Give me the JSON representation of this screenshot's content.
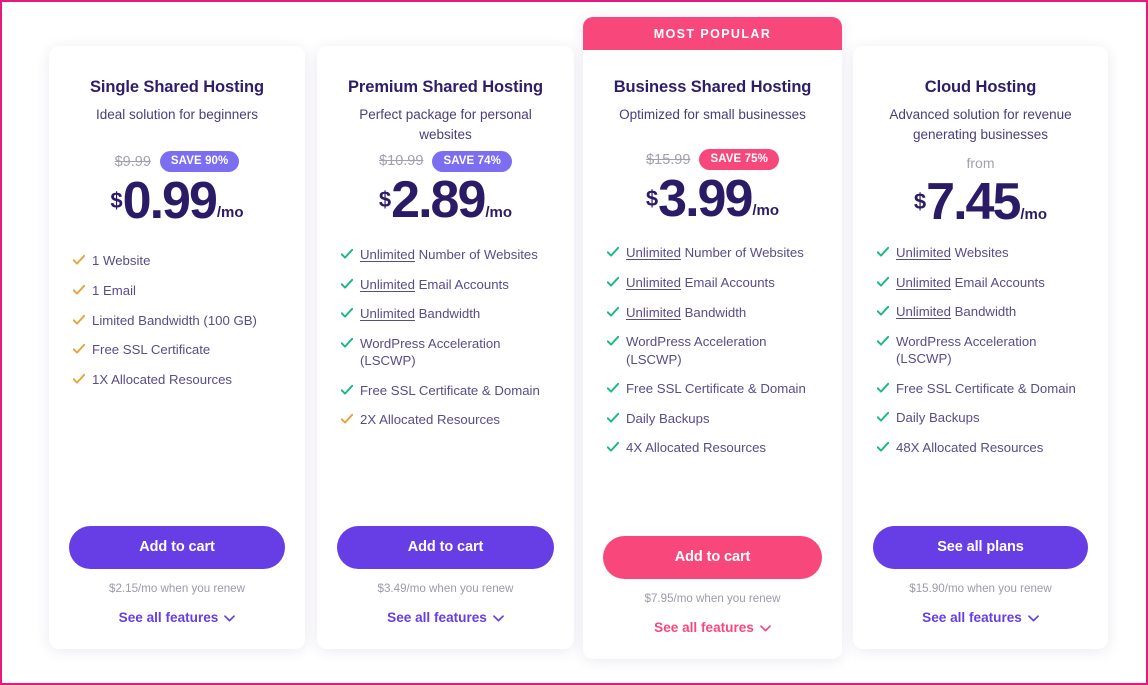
{
  "accent": {
    "purple": "#673de6",
    "badge_purple": "#7c6ef0",
    "pink": "#f8487b",
    "title_navy": "#2f1c6a",
    "check_green": "#19b97d",
    "check_orange": "#e8a33d",
    "page_border": "#e5187f"
  },
  "ribbon": {
    "label": "MOST POPULAR"
  },
  "plans": [
    {
      "id": "single-shared-hosting",
      "title": "Single Shared Hosting",
      "subtitle": "Ideal solution for beginners",
      "old_price": "$9.99",
      "save_badge": "SAVE 90%",
      "from_label": "",
      "currency": "$",
      "price": "0.99",
      "period": "/mo",
      "features": [
        {
          "highlight": "",
          "text": "1 Website",
          "check": "orange"
        },
        {
          "highlight": "",
          "text": "1 Email",
          "check": "orange"
        },
        {
          "highlight": "",
          "text": "Limited Bandwidth (100 GB)",
          "check": "orange"
        },
        {
          "highlight": "",
          "text": "Free SSL Certificate",
          "check": "orange"
        },
        {
          "highlight": "",
          "text": "1X Allocated Resources",
          "check": "orange"
        }
      ],
      "cta_label": "Add to cart",
      "renew_note": "$2.15/mo when you renew",
      "see_all_label": "See all features"
    },
    {
      "id": "premium-shared-hosting",
      "title": "Premium Shared Hosting",
      "subtitle": "Perfect package for personal websites",
      "old_price": "$10.99",
      "save_badge": "SAVE 74%",
      "from_label": "",
      "currency": "$",
      "price": "2.89",
      "period": "/mo",
      "features": [
        {
          "highlight": "Unlimited",
          "text": " Number of Websites",
          "check": "green"
        },
        {
          "highlight": "Unlimited",
          "text": " Email Accounts",
          "check": "green"
        },
        {
          "highlight": "Unlimited",
          "text": " Bandwidth",
          "check": "green"
        },
        {
          "highlight": "",
          "text": "WordPress Acceleration (LSCWP)",
          "check": "green"
        },
        {
          "highlight": "",
          "text": "Free SSL Certificate & Domain",
          "check": "green"
        },
        {
          "highlight": "",
          "text": "2X Allocated Resources",
          "check": "orange"
        }
      ],
      "cta_label": "Add to cart",
      "renew_note": "$3.49/mo when you renew",
      "see_all_label": "See all features"
    },
    {
      "id": "business-shared-hosting",
      "title": "Business Shared Hosting",
      "subtitle": "Optimized for small businesses",
      "old_price": "$15.99",
      "save_badge": "SAVE 75%",
      "from_label": "",
      "currency": "$",
      "price": "3.99",
      "period": "/mo",
      "features": [
        {
          "highlight": "Unlimited",
          "text": " Number of Websites",
          "check": "green"
        },
        {
          "highlight": "Unlimited",
          "text": " Email Accounts",
          "check": "green"
        },
        {
          "highlight": "Unlimited",
          "text": " Bandwidth",
          "check": "green"
        },
        {
          "highlight": "",
          "text": "WordPress Acceleration (LSCWP)",
          "check": "green"
        },
        {
          "highlight": "",
          "text": "Free SSL Certificate & Domain",
          "check": "green"
        },
        {
          "highlight": "",
          "text": "Daily Backups",
          "check": "green"
        },
        {
          "highlight": "",
          "text": "4X Allocated Resources",
          "check": "green"
        }
      ],
      "cta_label": "Add to cart",
      "renew_note": "$7.95/mo when you renew",
      "see_all_label": "See all features"
    },
    {
      "id": "cloud-hosting",
      "title": "Cloud Hosting",
      "subtitle": "Advanced solution for revenue generating businesses",
      "old_price": "",
      "save_badge": "",
      "from_label": "from",
      "currency": "$",
      "price": "7.45",
      "period": "/mo",
      "features": [
        {
          "highlight": "Unlimited",
          "text": " Websites",
          "check": "green"
        },
        {
          "highlight": "Unlimited",
          "text": " Email Accounts",
          "check": "green"
        },
        {
          "highlight": "Unlimited",
          "text": " Bandwidth",
          "check": "green"
        },
        {
          "highlight": "",
          "text": "WordPress Acceleration (LSCWP)",
          "check": "green"
        },
        {
          "highlight": "",
          "text": "Free SSL Certificate & Domain",
          "check": "green"
        },
        {
          "highlight": "",
          "text": "Daily Backups",
          "check": "green"
        },
        {
          "highlight": "",
          "text": "48X Allocated Resources",
          "check": "green"
        }
      ],
      "cta_label": "See all plans",
      "renew_note": "$15.90/mo when you renew",
      "see_all_label": "See all features"
    }
  ]
}
